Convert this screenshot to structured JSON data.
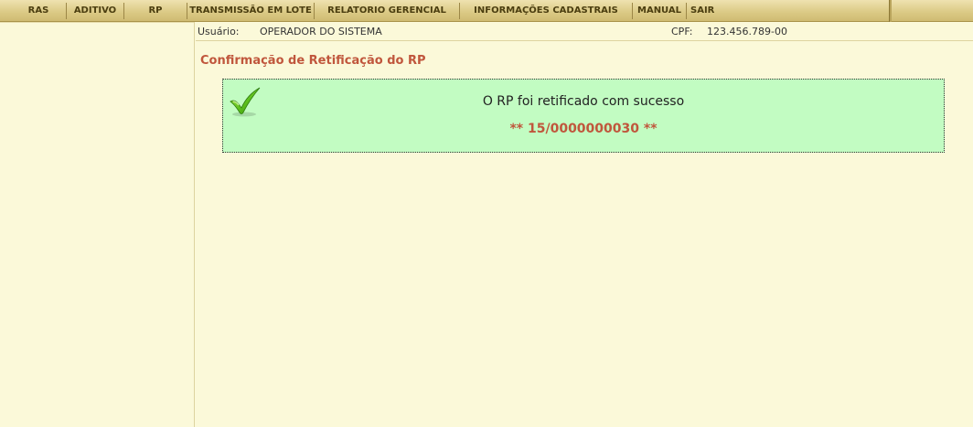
{
  "menu": {
    "items": [
      {
        "label": "RAS"
      },
      {
        "label": "ADITIVO"
      },
      {
        "label": "RP"
      },
      {
        "label": "TRANSMISSÃO EM LOTE"
      },
      {
        "label": "RELATORIO GERENCIAL"
      },
      {
        "label": "INFORMAÇÕES CADASTRAIS"
      },
      {
        "label": "MANUAL"
      },
      {
        "label": "SAIR"
      }
    ]
  },
  "user": {
    "user_label": "Usuário:",
    "user_name": "OPERADOR DO SISTEMA",
    "cpf_label": "CPF:",
    "cpf_value": "123.456.789-00"
  },
  "page": {
    "title": "Confirmação de Retificação do RP"
  },
  "message": {
    "icon": "checkmark-icon",
    "text": "O RP foi retificado com sucesso",
    "number": "** 15/0000000030 **",
    "box_color": "#c2fcc2",
    "accent_color": "#c0563c"
  }
}
